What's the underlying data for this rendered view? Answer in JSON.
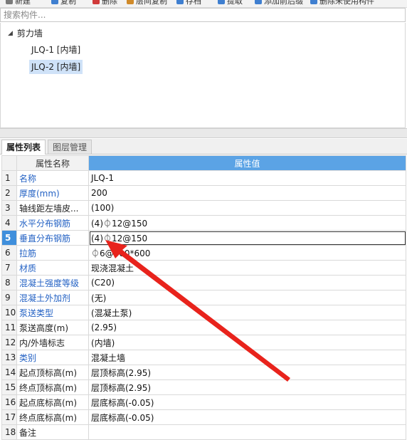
{
  "toolbar": {
    "items": [
      {
        "label": "新建",
        "icon": "new-icon",
        "color": "#7a7a7a"
      },
      {
        "label": "复制",
        "icon": "copy-icon",
        "color": "#3f7fd0"
      },
      {
        "label": "删除",
        "icon": "delete-icon",
        "color": "#d03a3a"
      },
      {
        "label": "层间复制",
        "icon": "floor-copy-icon",
        "color": "#d08a2a"
      },
      {
        "label": "存档",
        "icon": "archive-icon",
        "color": "#3f7fd0"
      },
      {
        "label": "提取",
        "icon": "extract-icon",
        "color": "#3f7fd0"
      },
      {
        "label": "添加前后缀",
        "icon": "add-prefix-icon",
        "color": "#3f7fd0"
      },
      {
        "label": "删除未使用构件",
        "icon": "delete-unused-icon",
        "color": "#3f7fd0"
      }
    ]
  },
  "search": {
    "placeholder": "搜索构件..."
  },
  "tree": {
    "root": "剪力墙",
    "children": [
      {
        "label": "JLQ-1 [内墙]",
        "selected": false
      },
      {
        "label": "JLQ-2 [内墙]",
        "selected": true
      }
    ]
  },
  "tabs": [
    {
      "label": "属性列表",
      "active": true
    },
    {
      "label": "图层管理",
      "active": false
    }
  ],
  "table": {
    "headers": {
      "name": "属性名称",
      "value": "属性值"
    },
    "rows": [
      {
        "num": "1",
        "name": "名称",
        "value": "JLQ-1",
        "link": true
      },
      {
        "num": "2",
        "name": "厚度(mm)",
        "value": "200",
        "link": true
      },
      {
        "num": "3",
        "name": "轴线距左墙皮...",
        "value": "(100)",
        "link": false
      },
      {
        "num": "4",
        "name": "水平分布钢筋",
        "value": "(4)⏀12@150",
        "link": true
      },
      {
        "num": "5",
        "name": "垂直分布钢筋",
        "value": "(4)⏀12@150",
        "link": true,
        "selected": true
      },
      {
        "num": "6",
        "name": "拉筋",
        "value": "⏀6@600*600",
        "link": true
      },
      {
        "num": "7",
        "name": "材质",
        "value": "现浇混凝土",
        "link": true
      },
      {
        "num": "8",
        "name": "混凝土强度等级",
        "value": "(C20)",
        "link": true
      },
      {
        "num": "9",
        "name": "混凝土外加剂",
        "value": "(无)",
        "link": true
      },
      {
        "num": "10",
        "name": "泵送类型",
        "value": "(混凝土泵)",
        "link": true
      },
      {
        "num": "11",
        "name": "泵送高度(m)",
        "value": "(2.95)",
        "link": false
      },
      {
        "num": "12",
        "name": "内/外墙标志",
        "value": "(内墙)",
        "link": false
      },
      {
        "num": "13",
        "name": "类别",
        "value": "混凝土墙",
        "link": true
      },
      {
        "num": "14",
        "name": "起点顶标高(m)",
        "value": "层顶标高(2.95)",
        "link": false
      },
      {
        "num": "15",
        "name": "终点顶标高(m)",
        "value": "层顶标高(2.95)",
        "link": false
      },
      {
        "num": "16",
        "name": "起点底标高(m)",
        "value": "层底标高(-0.05)",
        "link": false
      },
      {
        "num": "17",
        "name": "终点底标高(m)",
        "value": "层底标高(-0.05)",
        "link": false
      },
      {
        "num": "18",
        "name": "备注",
        "value": "",
        "link": false
      }
    ]
  },
  "annotation": {
    "color": "#e8231c"
  }
}
